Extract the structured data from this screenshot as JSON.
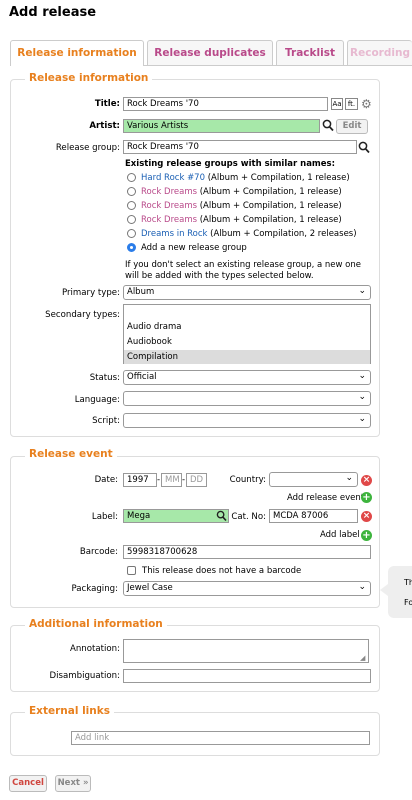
{
  "page_title": "Add release",
  "tabs": [
    {
      "label": "Release information"
    },
    {
      "label": "Release duplicates"
    },
    {
      "label": "Tracklist"
    },
    {
      "label": "Recording"
    }
  ],
  "release_info": {
    "legend": "Release information",
    "title_label": "Title:",
    "title_value": "Rock Dreams '70",
    "artist_label": "Artist:",
    "artist_value": "Various Artists",
    "edit_label": "Edit",
    "rg_label": "Release group:",
    "rg_value": "Rock Dreams '70",
    "existing_heading": "Existing release groups with similar names:",
    "rg_options": [
      {
        "name": "Hard Rock #70",
        "meta": " (Album + Compilation, 1 release)"
      },
      {
        "name": "Rock Dreams",
        "meta": " (Album + Compilation, 1 release)"
      },
      {
        "name": "Rock Dreams",
        "meta": " (Album + Compilation, 1 release)"
      },
      {
        "name": "Rock Dreams",
        "meta": " (Album + Compilation, 1 release)"
      },
      {
        "name": "Dreams in Rock",
        "meta": " (Album + Compilation, 2 releases)"
      },
      {
        "name": "Add a new release group",
        "meta": ""
      }
    ],
    "note_line1": "If you don't select an existing release group, a new one",
    "note_line2": "will be added with the types selected below.",
    "primary_type_label": "Primary type:",
    "primary_type_value": "Album",
    "secondary_types_label": "Secondary types:",
    "secondary_types": [
      "Audio drama",
      "Audiobook",
      "Compilation"
    ],
    "status_label": "Status:",
    "status_value": "Official",
    "language_label": "Language:",
    "language_value": "",
    "script_label": "Script:",
    "script_value": ""
  },
  "release_event": {
    "legend": "Release event",
    "date_label": "Date:",
    "year": "1997",
    "month_ph": "MM",
    "day_ph": "DD",
    "country_label": "Country:",
    "country_value": "",
    "add_event_label": "Add release event",
    "label_label": "Label:",
    "label_value": "Mega",
    "catno_label": "Cat. No:",
    "catno_value": "MCDA 87006",
    "add_label_label": "Add label",
    "barcode_label": "Barcode:",
    "barcode_value": "5998318700628",
    "no_barcode_label": "This release does not have a barcode",
    "packaging_label": "Packaging:",
    "packaging_value": "Jewel Case",
    "tooltip_line1": "Th",
    "tooltip_line2": "Fo"
  },
  "additional": {
    "legend": "Additional information",
    "annotation_label": "Annotation:",
    "disambiguation_label": "Disambiguation:"
  },
  "links": {
    "legend": "External links",
    "add_link_ph": "Add link"
  },
  "footer": {
    "cancel": "Cancel",
    "next": "Next »"
  },
  "colors": {
    "accent": "#e8801e",
    "tab_link": "#b94a8a",
    "artist_field_bg": "#a7e8a9",
    "remove": "#e04848",
    "add": "#3db43d"
  }
}
